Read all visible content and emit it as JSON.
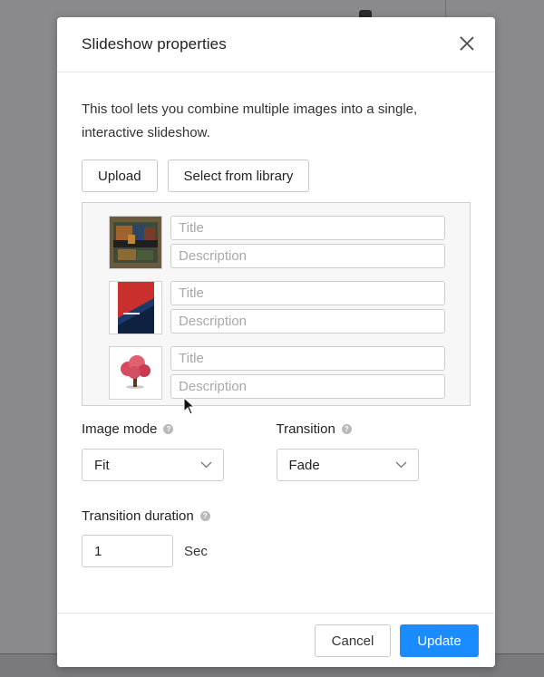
{
  "dialog": {
    "title": "Slideshow properties",
    "intro": "This tool lets you combine multiple images into a single, interactive slideshow."
  },
  "source_buttons": {
    "upload": "Upload",
    "library": "Select from library"
  },
  "images": [
    {
      "title_placeholder": "Title",
      "description_placeholder": "Description"
    },
    {
      "title_placeholder": "Title",
      "description_placeholder": "Description"
    },
    {
      "title_placeholder": "Title",
      "description_placeholder": "Description"
    }
  ],
  "image_mode": {
    "label": "Image mode",
    "value": "Fit"
  },
  "transition": {
    "label": "Transition",
    "value": "Fade"
  },
  "transition_duration": {
    "label": "Transition duration",
    "value": "1",
    "unit": "Sec"
  },
  "footer": {
    "cancel": "Cancel",
    "update": "Update"
  },
  "colors": {
    "primary": "#1a8cff",
    "overlay": "#8a8a8c"
  }
}
